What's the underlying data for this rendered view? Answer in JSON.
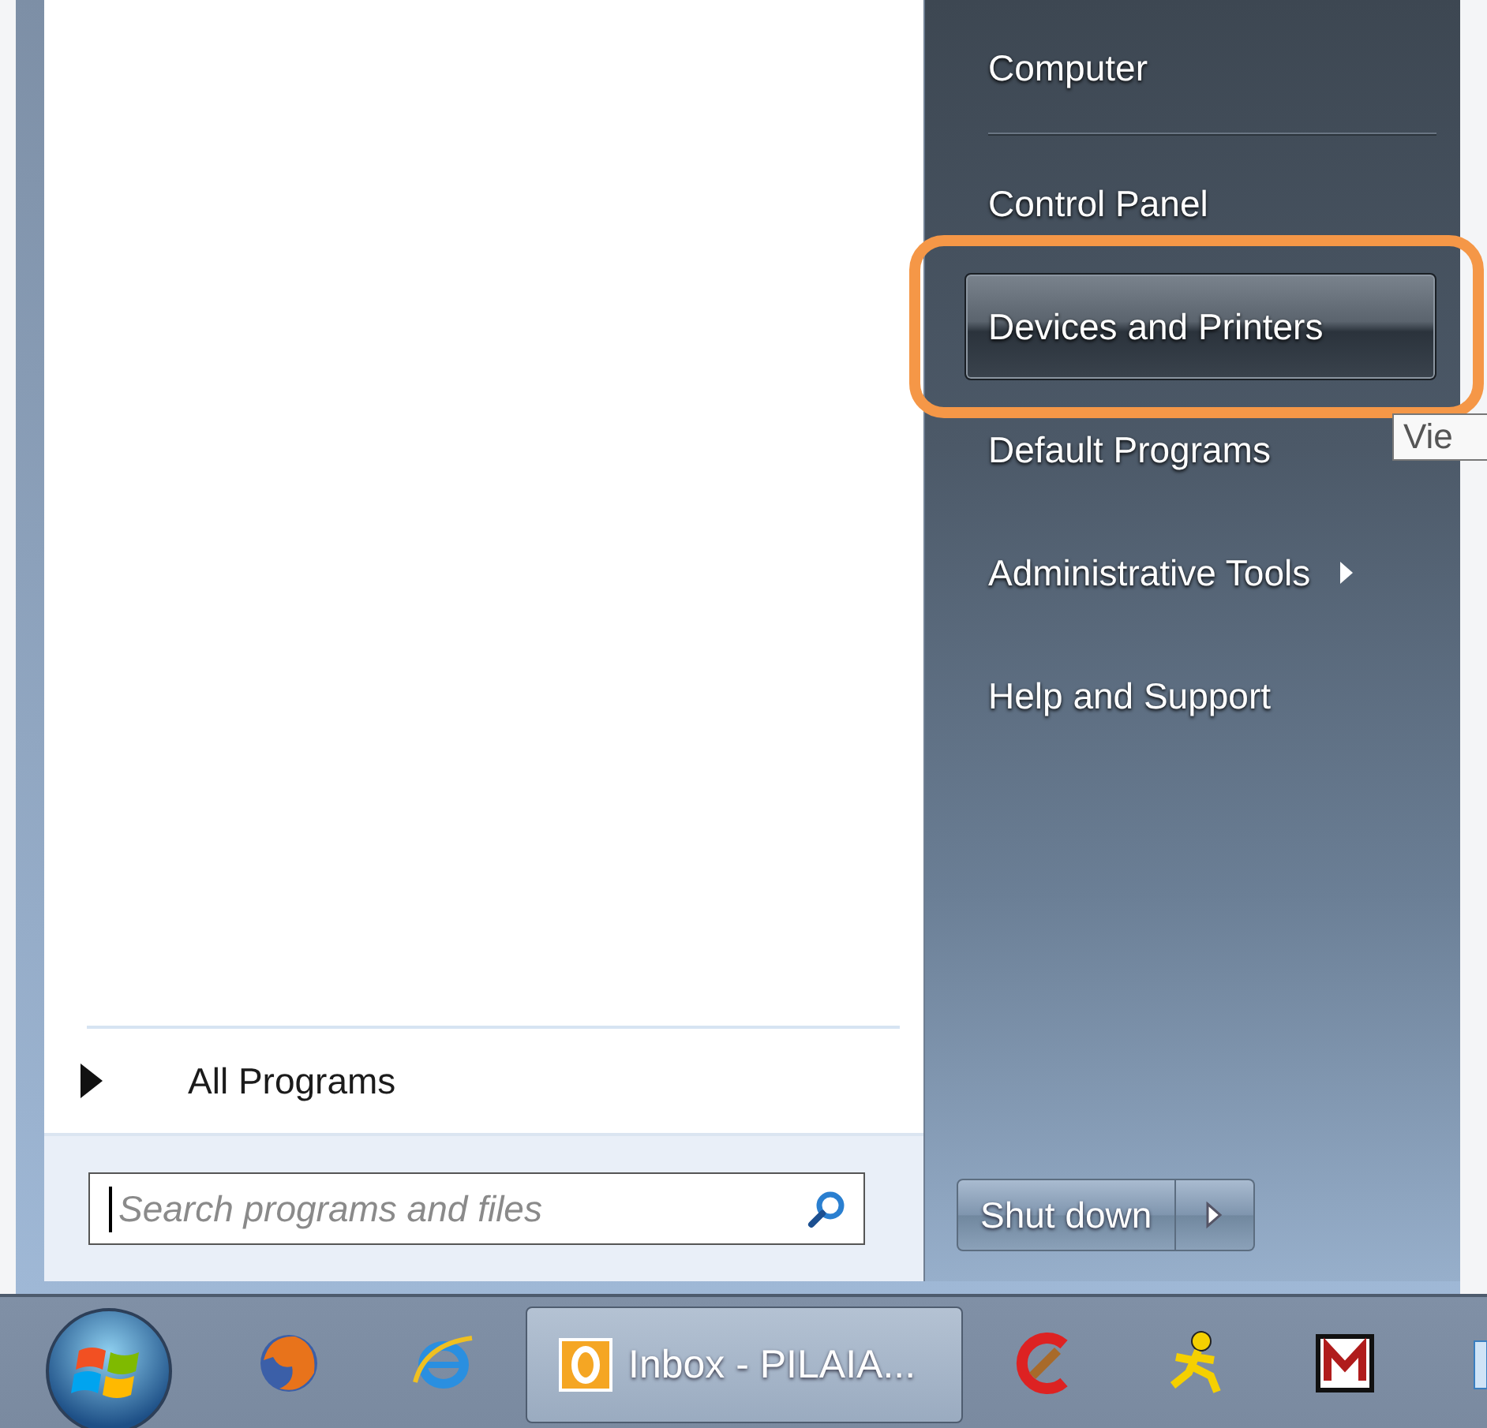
{
  "start_menu": {
    "all_programs": {
      "label": "All Programs"
    },
    "search": {
      "placeholder": "Search programs and files"
    },
    "right_items": [
      {
        "kind": "item",
        "label": "Computer",
        "selected": false,
        "submenu": false
      },
      {
        "kind": "separator"
      },
      {
        "kind": "item",
        "label": "Control Panel",
        "selected": false,
        "submenu": false
      },
      {
        "kind": "item",
        "label": "Devices and Printers",
        "selected": true,
        "submenu": false
      },
      {
        "kind": "item",
        "label": "Default Programs",
        "selected": false,
        "submenu": false
      },
      {
        "kind": "item",
        "label": "Administrative Tools",
        "selected": false,
        "submenu": true
      },
      {
        "kind": "item",
        "label": "Help and Support",
        "selected": false,
        "submenu": false
      }
    ],
    "shutdown": {
      "label": "Shut down"
    }
  },
  "tooltip": {
    "text": "Vie"
  },
  "taskbar": {
    "task": {
      "label": "Inbox - PILAIA..."
    }
  }
}
